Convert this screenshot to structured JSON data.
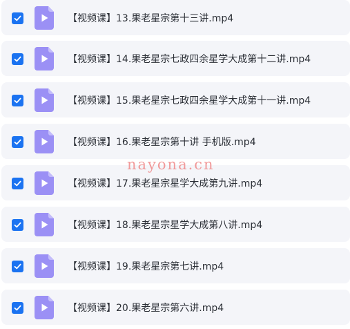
{
  "files": [
    {
      "name": "【视频课】13.果老星宗第十三讲.mp4",
      "checked": true
    },
    {
      "name": "【视频课】14.果老星宗七政四余星学大成第十二讲.mp4",
      "checked": true
    },
    {
      "name": "【视频课】15.果老星宗七政四余星学大成第十一讲.mp4",
      "checked": true
    },
    {
      "name": "【视频课】16.果老星宗第十讲 手机版.mp4",
      "checked": true
    },
    {
      "name": "【视频课】17.果老星宗星学大成第九讲.mp4",
      "checked": true
    },
    {
      "name": "【视频课】18.果老星宗星学大成第八讲.mp4",
      "checked": true
    },
    {
      "name": "【视频课】19.果老星宗第七讲.mp4",
      "checked": true
    },
    {
      "name": "【视频课】20.果老星宗第六讲.mp4",
      "checked": true
    }
  ],
  "icons": {
    "file": "video-file-icon",
    "check": "checkbox-checked-icon"
  },
  "colors": {
    "checkbox": "#1b73f1",
    "file_icon": "#9b90f5",
    "row_background": "#f4f5f9",
    "watermark": "#f08a8a"
  },
  "watermark": "nayona.cn"
}
